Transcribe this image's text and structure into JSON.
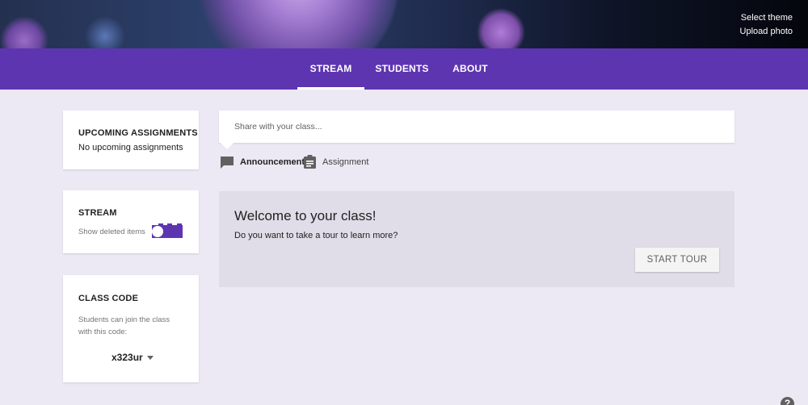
{
  "banner": {
    "select_theme": "Select theme",
    "upload_photo": "Upload photo"
  },
  "nav": {
    "tabs": [
      {
        "label": "STREAM",
        "active": true
      },
      {
        "label": "STUDENTS",
        "active": false
      },
      {
        "label": "ABOUT",
        "active": false
      }
    ]
  },
  "sidebar": {
    "upcoming": {
      "title": "UPCOMING ASSIGNMENTS",
      "text": "No upcoming assignments"
    },
    "stream": {
      "title": "STREAM",
      "toggle_label": "Show deleted items",
      "toggle_on": true
    },
    "class_code": {
      "title": "CLASS CODE",
      "description": "Students can join the class with this code:",
      "code": "x323ur"
    }
  },
  "share": {
    "placeholder": "Share with your class..."
  },
  "post_actions": {
    "announcement": "Announcement",
    "assignment": "Assignment"
  },
  "welcome": {
    "title": "Welcome to your class!",
    "text": "Do you want to take a tour to learn more?",
    "button": "START TOUR"
  },
  "help": {
    "label": "?"
  },
  "colors": {
    "accent": "#5e35b1",
    "background": "#ece9f4",
    "welcome_bg": "#e0dde8"
  }
}
